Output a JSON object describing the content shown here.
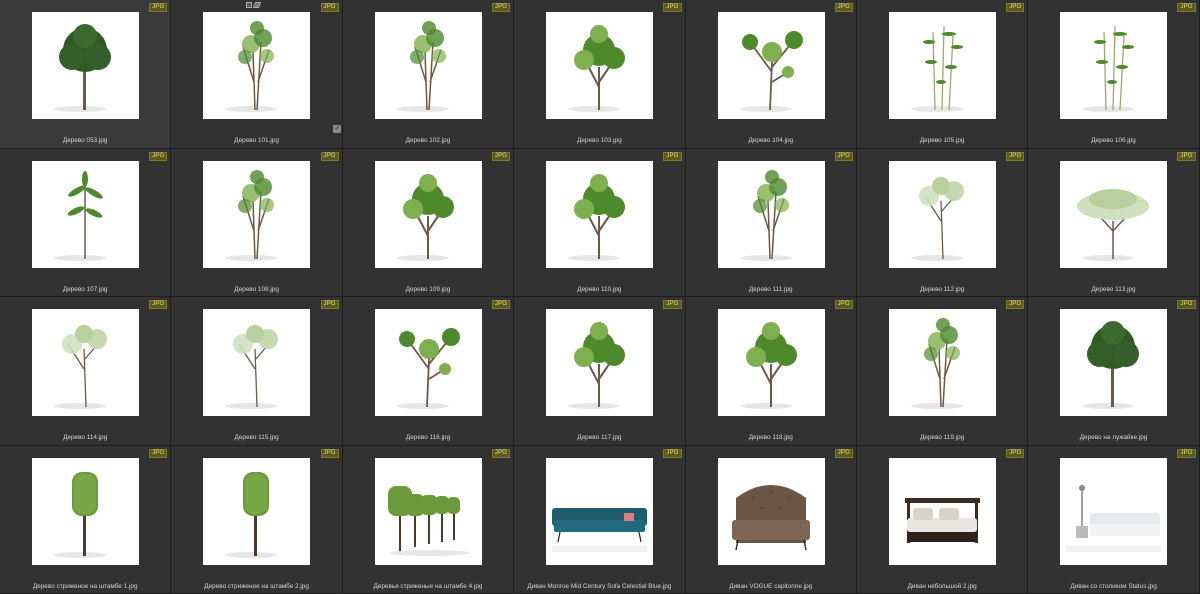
{
  "badge": "JPG",
  "selected_item": {
    "check_glyph": "✓",
    "tool_icons": [
      "square-select-icon",
      "pen-icon"
    ]
  },
  "items": [
    {
      "caption": "Дерево 053.jpg",
      "kind": "tree-dense"
    },
    {
      "caption": "Дерево 101.jpg",
      "kind": "tree-tall"
    },
    {
      "caption": "Дерево 102.jpg",
      "kind": "tree-tall"
    },
    {
      "caption": "Дерево 103.jpg",
      "kind": "tree-bushy"
    },
    {
      "caption": "Дерево 104.jpg",
      "kind": "tree-branchy"
    },
    {
      "caption": "Дерево 105.jpg",
      "kind": "tree-bamboo"
    },
    {
      "caption": "Дерево 106.jpg",
      "kind": "tree-bamboo"
    },
    {
      "caption": "Дерево 107.jpg",
      "kind": "tree-palm"
    },
    {
      "caption": "Дерево 108.jpg",
      "kind": "tree-tall"
    },
    {
      "caption": "Дерево 109.jpg",
      "kind": "tree-bushy"
    },
    {
      "caption": "Дерево 110.jpg",
      "kind": "tree-bushy"
    },
    {
      "caption": "Дерево 111.jpg",
      "kind": "tree-tall"
    },
    {
      "caption": "Дерево 112.jpg",
      "kind": "tree-sparse"
    },
    {
      "caption": "Дерево 113.jpg",
      "kind": "tree-wide"
    },
    {
      "caption": "Дерево 114.jpg",
      "kind": "tree-sparse"
    },
    {
      "caption": "Дерево 115.jpg",
      "kind": "tree-sparse"
    },
    {
      "caption": "Дерево 116.jpg",
      "kind": "tree-branchy"
    },
    {
      "caption": "Дерево 117.jpg",
      "kind": "tree-bushy"
    },
    {
      "caption": "Дерево 118.jpg",
      "kind": "tree-bushy"
    },
    {
      "caption": "Дерево 119.jpg",
      "kind": "tree-tall"
    },
    {
      "caption": "Дерево на лужайке.jpg",
      "kind": "tree-dense"
    },
    {
      "caption": "Дерево стриженое на штамбе 1.jpg",
      "kind": "topiary"
    },
    {
      "caption": "Дерево стриженое на штамбе 2.jpg",
      "kind": "topiary"
    },
    {
      "caption": "Деревья стриженые на штамбе 4.jpg",
      "kind": "topiary-row"
    },
    {
      "caption": "Диван Monroe Mid Century Sofa Celestial Blue.jpg",
      "kind": "sofa-blue"
    },
    {
      "caption": "Диван VOGUE capitonne.jpg",
      "kind": "sofa-chesterfield"
    },
    {
      "caption": "Диван небольшой 2.jpg",
      "kind": "daybed"
    },
    {
      "caption": "Диван со столиком Status.jpg",
      "kind": "sofa-white"
    }
  ]
}
